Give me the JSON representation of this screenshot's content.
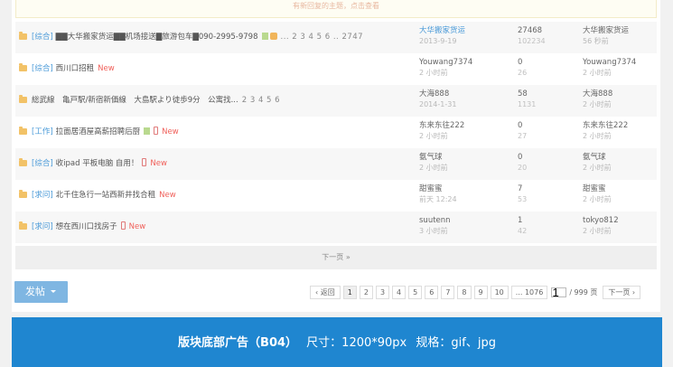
{
  "notice": "有新回复的主题，点击查看",
  "threads": [
    {
      "category": "[综合]",
      "title": "▇▇大华搬家货运▇▇机场接送▇旅游包车▇090-2995-9798",
      "attach": true,
      "hot": true,
      "pages": "... 2 3 4 5 6 .. 2747",
      "phone": false,
      "new": false,
      "author": "大华搬家货运",
      "author_blue": true,
      "date": "2013-9-19",
      "replies": "27468",
      "views": "102234",
      "last_user": "大华搬家货运",
      "last_time": "56 秒前"
    },
    {
      "category": "[综合]",
      "title": "西川口招租",
      "attach": false,
      "hot": false,
      "pages": "",
      "phone": false,
      "new": true,
      "author": "Youwang7374",
      "author_blue": false,
      "date": "2 小时前",
      "replies": "0",
      "views": "26",
      "last_user": "Youwang7374",
      "last_time": "2 小时前"
    },
    {
      "category": "",
      "title": "総武線　亀戸駅/新宿新価線　大島駅より徒歩9分　公寓找...",
      "attach": false,
      "hot": false,
      "pages": "2 3 4 5 6",
      "phone": false,
      "new": false,
      "author": "大海888",
      "author_blue": false,
      "date": "2014-1-31",
      "replies": "58",
      "views": "1131",
      "last_user": "大海888",
      "last_time": "2 小时前"
    },
    {
      "category": "[工作]",
      "title": "拉面居酒屋高薪招聘后厨",
      "attach": true,
      "hot": false,
      "pages": "",
      "phone": true,
      "new": true,
      "author": "东来东往222",
      "author_blue": false,
      "date": "2 小时前",
      "replies": "0",
      "views": "27",
      "last_user": "东来东往222",
      "last_time": "2 小时前"
    },
    {
      "category": "[综合]",
      "title": "收ipad 平板电脑 自用！",
      "attach": false,
      "hot": false,
      "pages": "",
      "phone": true,
      "new": true,
      "author": "氨气球",
      "author_blue": false,
      "date": "2 小时前",
      "replies": "0",
      "views": "20",
      "last_user": "氨气球",
      "last_time": "2 小时前"
    },
    {
      "category": "[求问]",
      "title": "北千住急行一站西新井找合租",
      "attach": false,
      "hot": false,
      "pages": "",
      "phone": false,
      "new": true,
      "author": "甜蜜蜜",
      "author_blue": false,
      "date": "前天 12:24",
      "replies": "7",
      "views": "53",
      "last_user": "甜蜜蜜",
      "last_time": "2 小时前"
    },
    {
      "category": "[求问]",
      "title": "想在西川口找房子",
      "attach": false,
      "hot": false,
      "pages": "",
      "phone": true,
      "new": true,
      "author": "suutenn",
      "author_blue": false,
      "date": "3 小时前",
      "replies": "1",
      "views": "42",
      "last_user": "tokyo812",
      "last_time": "2 小时前"
    }
  ],
  "new_label": "New",
  "next_page": "下一页 »",
  "post_button": "发帖",
  "pager": {
    "prev": "‹ 返回",
    "pages": [
      "1",
      "2",
      "3",
      "4",
      "5",
      "6",
      "7",
      "8",
      "9",
      "10",
      "... 1076"
    ],
    "current": "1",
    "total": "/ 999 页",
    "next": "下一页 ›"
  },
  "banner": {
    "title": "版块底部广告（B04）",
    "size": "尺寸：1200*90px",
    "spec": "规格：gif、jpg"
  }
}
